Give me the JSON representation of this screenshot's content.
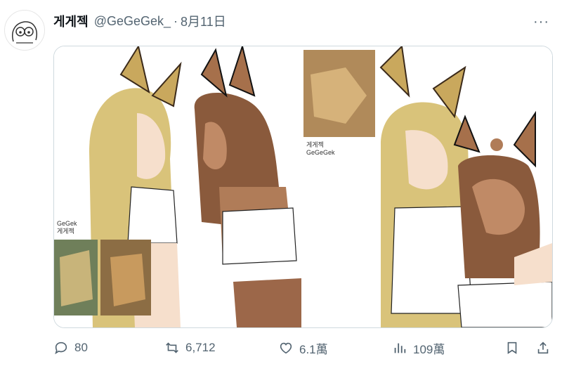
{
  "tweet": {
    "author_name": "게게젝",
    "handle": "@GeGeGek_",
    "separator": "·",
    "date": "8月11日",
    "more_label": "···"
  },
  "media": {
    "left_photo_caption_1": "GeGek",
    "left_photo_caption_2": "게게젝",
    "right_photo_caption_1": "게게젝",
    "right_photo_caption_2": "GeGeGek"
  },
  "actions": {
    "replies": "80",
    "retweets": "6,712",
    "likes": "6.1萬",
    "views": "109萬"
  },
  "colors": {
    "text_primary": "#0f1419",
    "text_secondary": "#536471",
    "border": "#cfd9de"
  },
  "icons": [
    "reply-icon",
    "retweet-icon",
    "like-icon",
    "views-icon",
    "bookmark-icon",
    "share-icon",
    "more-icon"
  ]
}
